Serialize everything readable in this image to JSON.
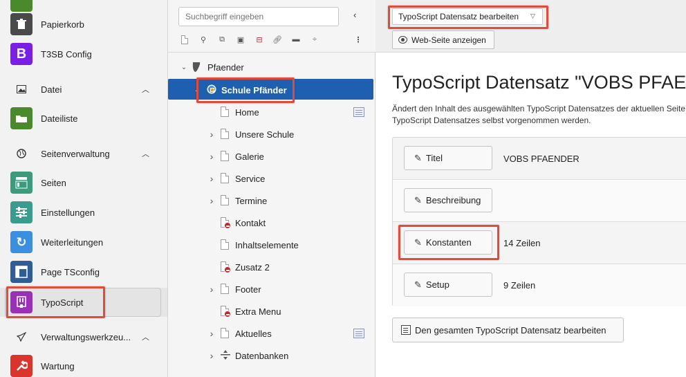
{
  "module_menu": {
    "items": [
      {
        "label": "Papierkorb",
        "icon": "trash-icon",
        "color": "#4a4a4a"
      },
      {
        "label": "T3SB Config",
        "icon": "bootstrap-icon",
        "color": "#7a1fe6"
      },
      {
        "label": "Dateiliste",
        "icon": "folder-cloud-icon",
        "color": "#4b8a2c"
      },
      {
        "label": "Seiten",
        "icon": "pages-icon",
        "color": "#3a9b7d"
      },
      {
        "label": "Einstellungen",
        "icon": "settings-sliders-icon",
        "color": "#3a9b8e"
      },
      {
        "label": "Weiterleitungen",
        "icon": "redirect-icon",
        "color": "#3b8fe0"
      },
      {
        "label": "Page TSconfig",
        "icon": "layout-icon",
        "color": "#2f5d96"
      },
      {
        "label": "TypoScript",
        "icon": "typoscript-icon",
        "color": "#9a2fb8"
      },
      {
        "label": "Wartung",
        "icon": "wrench-icon",
        "color": "#d9352c"
      }
    ],
    "groups": [
      {
        "label": "Datei",
        "icon": "image-icon"
      },
      {
        "label": "Seitenverwaltung",
        "icon": "globe-icon"
      },
      {
        "label": "Verwaltungswerkzeu...",
        "icon": "rocket-icon"
      }
    ]
  },
  "page_tree": {
    "search_placeholder": "Suchbegriff eingeben",
    "root": "Pfaender",
    "selected": "Schule Pfänder",
    "nodes": [
      {
        "label": "Home",
        "expandable": false,
        "restricted": false
      },
      {
        "label": "Unsere Schule",
        "expandable": true,
        "restricted": false
      },
      {
        "label": "Galerie",
        "expandable": true,
        "restricted": false
      },
      {
        "label": "Service",
        "expandable": true,
        "restricted": false
      },
      {
        "label": "Termine",
        "expandable": true,
        "restricted": false
      },
      {
        "label": "Kontakt",
        "expandable": false,
        "restricted": true
      },
      {
        "label": "Inhaltselemente",
        "expandable": false,
        "restricted": false
      },
      {
        "label": "Zusatz 2",
        "expandable": false,
        "restricted": true
      },
      {
        "label": "Footer",
        "expandable": true,
        "restricted": false
      },
      {
        "label": "Extra Menu",
        "expandable": false,
        "restricted": true
      },
      {
        "label": "Aktuelles",
        "expandable": true,
        "restricted": false
      },
      {
        "label": "Datenbanken",
        "expandable": true,
        "restricted": false
      }
    ]
  },
  "doc_header": {
    "function_select": "TypoScript Datensatz bearbeiten",
    "view_button": "Web-Seite anzeigen"
  },
  "main": {
    "title": "TypoScript Datensatz \"VOBS PFAENDER\"",
    "intro_line1": "Ändert den Inhalt des ausgewählten TypoScript Datensatzes der aktuellen Seite.",
    "intro_line2": "TypoScript Datensatzes selbst vorgenommen werden.",
    "rows": [
      {
        "button": "Titel",
        "value": "VOBS PFAENDER"
      },
      {
        "button": "Beschreibung",
        "value": ""
      },
      {
        "button": "Konstanten",
        "value": "14 Zeilen"
      },
      {
        "button": "Setup",
        "value": "9 Zeilen"
      }
    ],
    "edit_all_button": "Den gesamten TypoScript Datensatz bearbeiten"
  },
  "colors": {
    "highlight": "#e04c3c",
    "tree_selected": "#1e5fb0"
  }
}
